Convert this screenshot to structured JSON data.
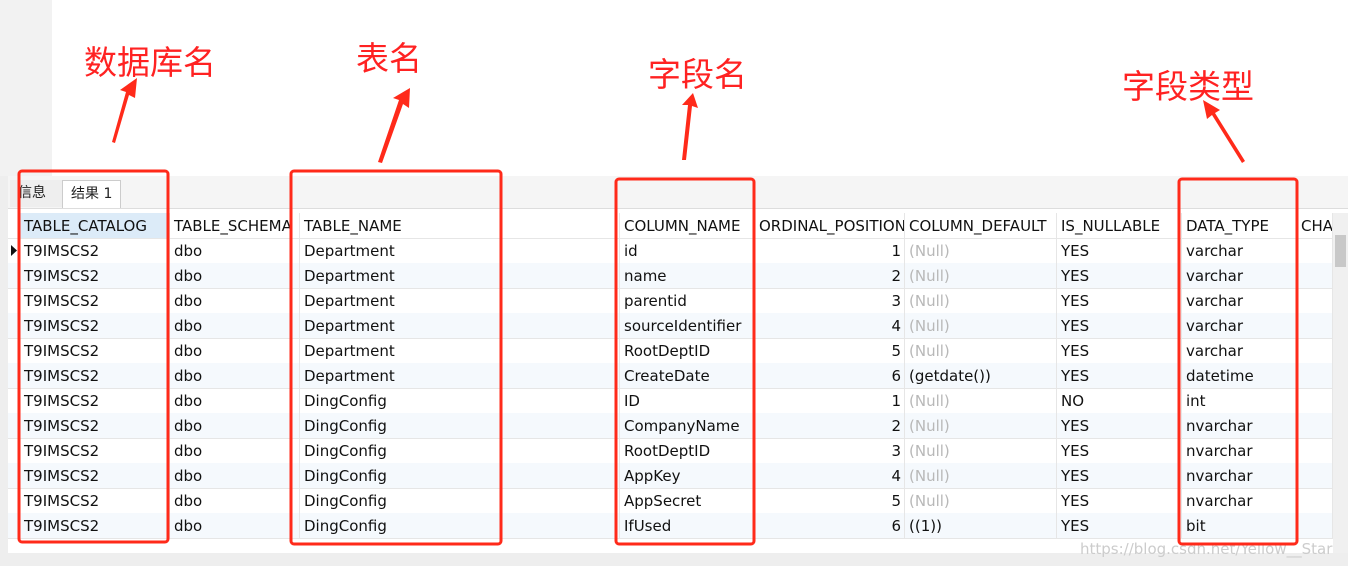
{
  "annotations": {
    "db_name": "数据库名",
    "table_name": "表名",
    "field_name": "字段名",
    "field_type": "字段类型",
    "color": "#ff2a1a"
  },
  "tabs": [
    {
      "label": "信息"
    },
    {
      "label": "结果 1"
    }
  ],
  "columns": [
    "TABLE_CATALOG",
    "TABLE_SCHEMA",
    "TABLE_NAME",
    "COLUMN_NAME",
    "ORDINAL_POSITION",
    "COLUMN_DEFAULT",
    "IS_NULLABLE",
    "DATA_TYPE",
    "CHA"
  ],
  "rows": [
    [
      "T9IMSCS2",
      "dbo",
      "Department",
      "id",
      "1",
      "(Null)",
      "YES",
      "varchar"
    ],
    [
      "T9IMSCS2",
      "dbo",
      "Department",
      "name",
      "2",
      "(Null)",
      "YES",
      "varchar"
    ],
    [
      "T9IMSCS2",
      "dbo",
      "Department",
      "parentid",
      "3",
      "(Null)",
      "YES",
      "varchar"
    ],
    [
      "T9IMSCS2",
      "dbo",
      "Department",
      "sourceIdentifier",
      "4",
      "(Null)",
      "YES",
      "varchar"
    ],
    [
      "T9IMSCS2",
      "dbo",
      "Department",
      "RootDeptID",
      "5",
      "(Null)",
      "YES",
      "varchar"
    ],
    [
      "T9IMSCS2",
      "dbo",
      "Department",
      "CreateDate",
      "6",
      "(getdate())",
      "YES",
      "datetime"
    ],
    [
      "T9IMSCS2",
      "dbo",
      "DingConfig",
      "ID",
      "1",
      "(Null)",
      "NO",
      "int"
    ],
    [
      "T9IMSCS2",
      "dbo",
      "DingConfig",
      "CompanyName",
      "2",
      "(Null)",
      "YES",
      "nvarchar"
    ],
    [
      "T9IMSCS2",
      "dbo",
      "DingConfig",
      "RootDeptID",
      "3",
      "(Null)",
      "YES",
      "nvarchar"
    ],
    [
      "T9IMSCS2",
      "dbo",
      "DingConfig",
      "AppKey",
      "4",
      "(Null)",
      "YES",
      "nvarchar"
    ],
    [
      "T9IMSCS2",
      "dbo",
      "DingConfig",
      "AppSecret",
      "5",
      "(Null)",
      "YES",
      "nvarchar"
    ],
    [
      "T9IMSCS2",
      "dbo",
      "DingConfig",
      "IfUsed",
      "6",
      "((1))",
      "YES",
      "bit"
    ]
  ],
  "watermark": "https://blog.csdn.net/Yellow__Star"
}
